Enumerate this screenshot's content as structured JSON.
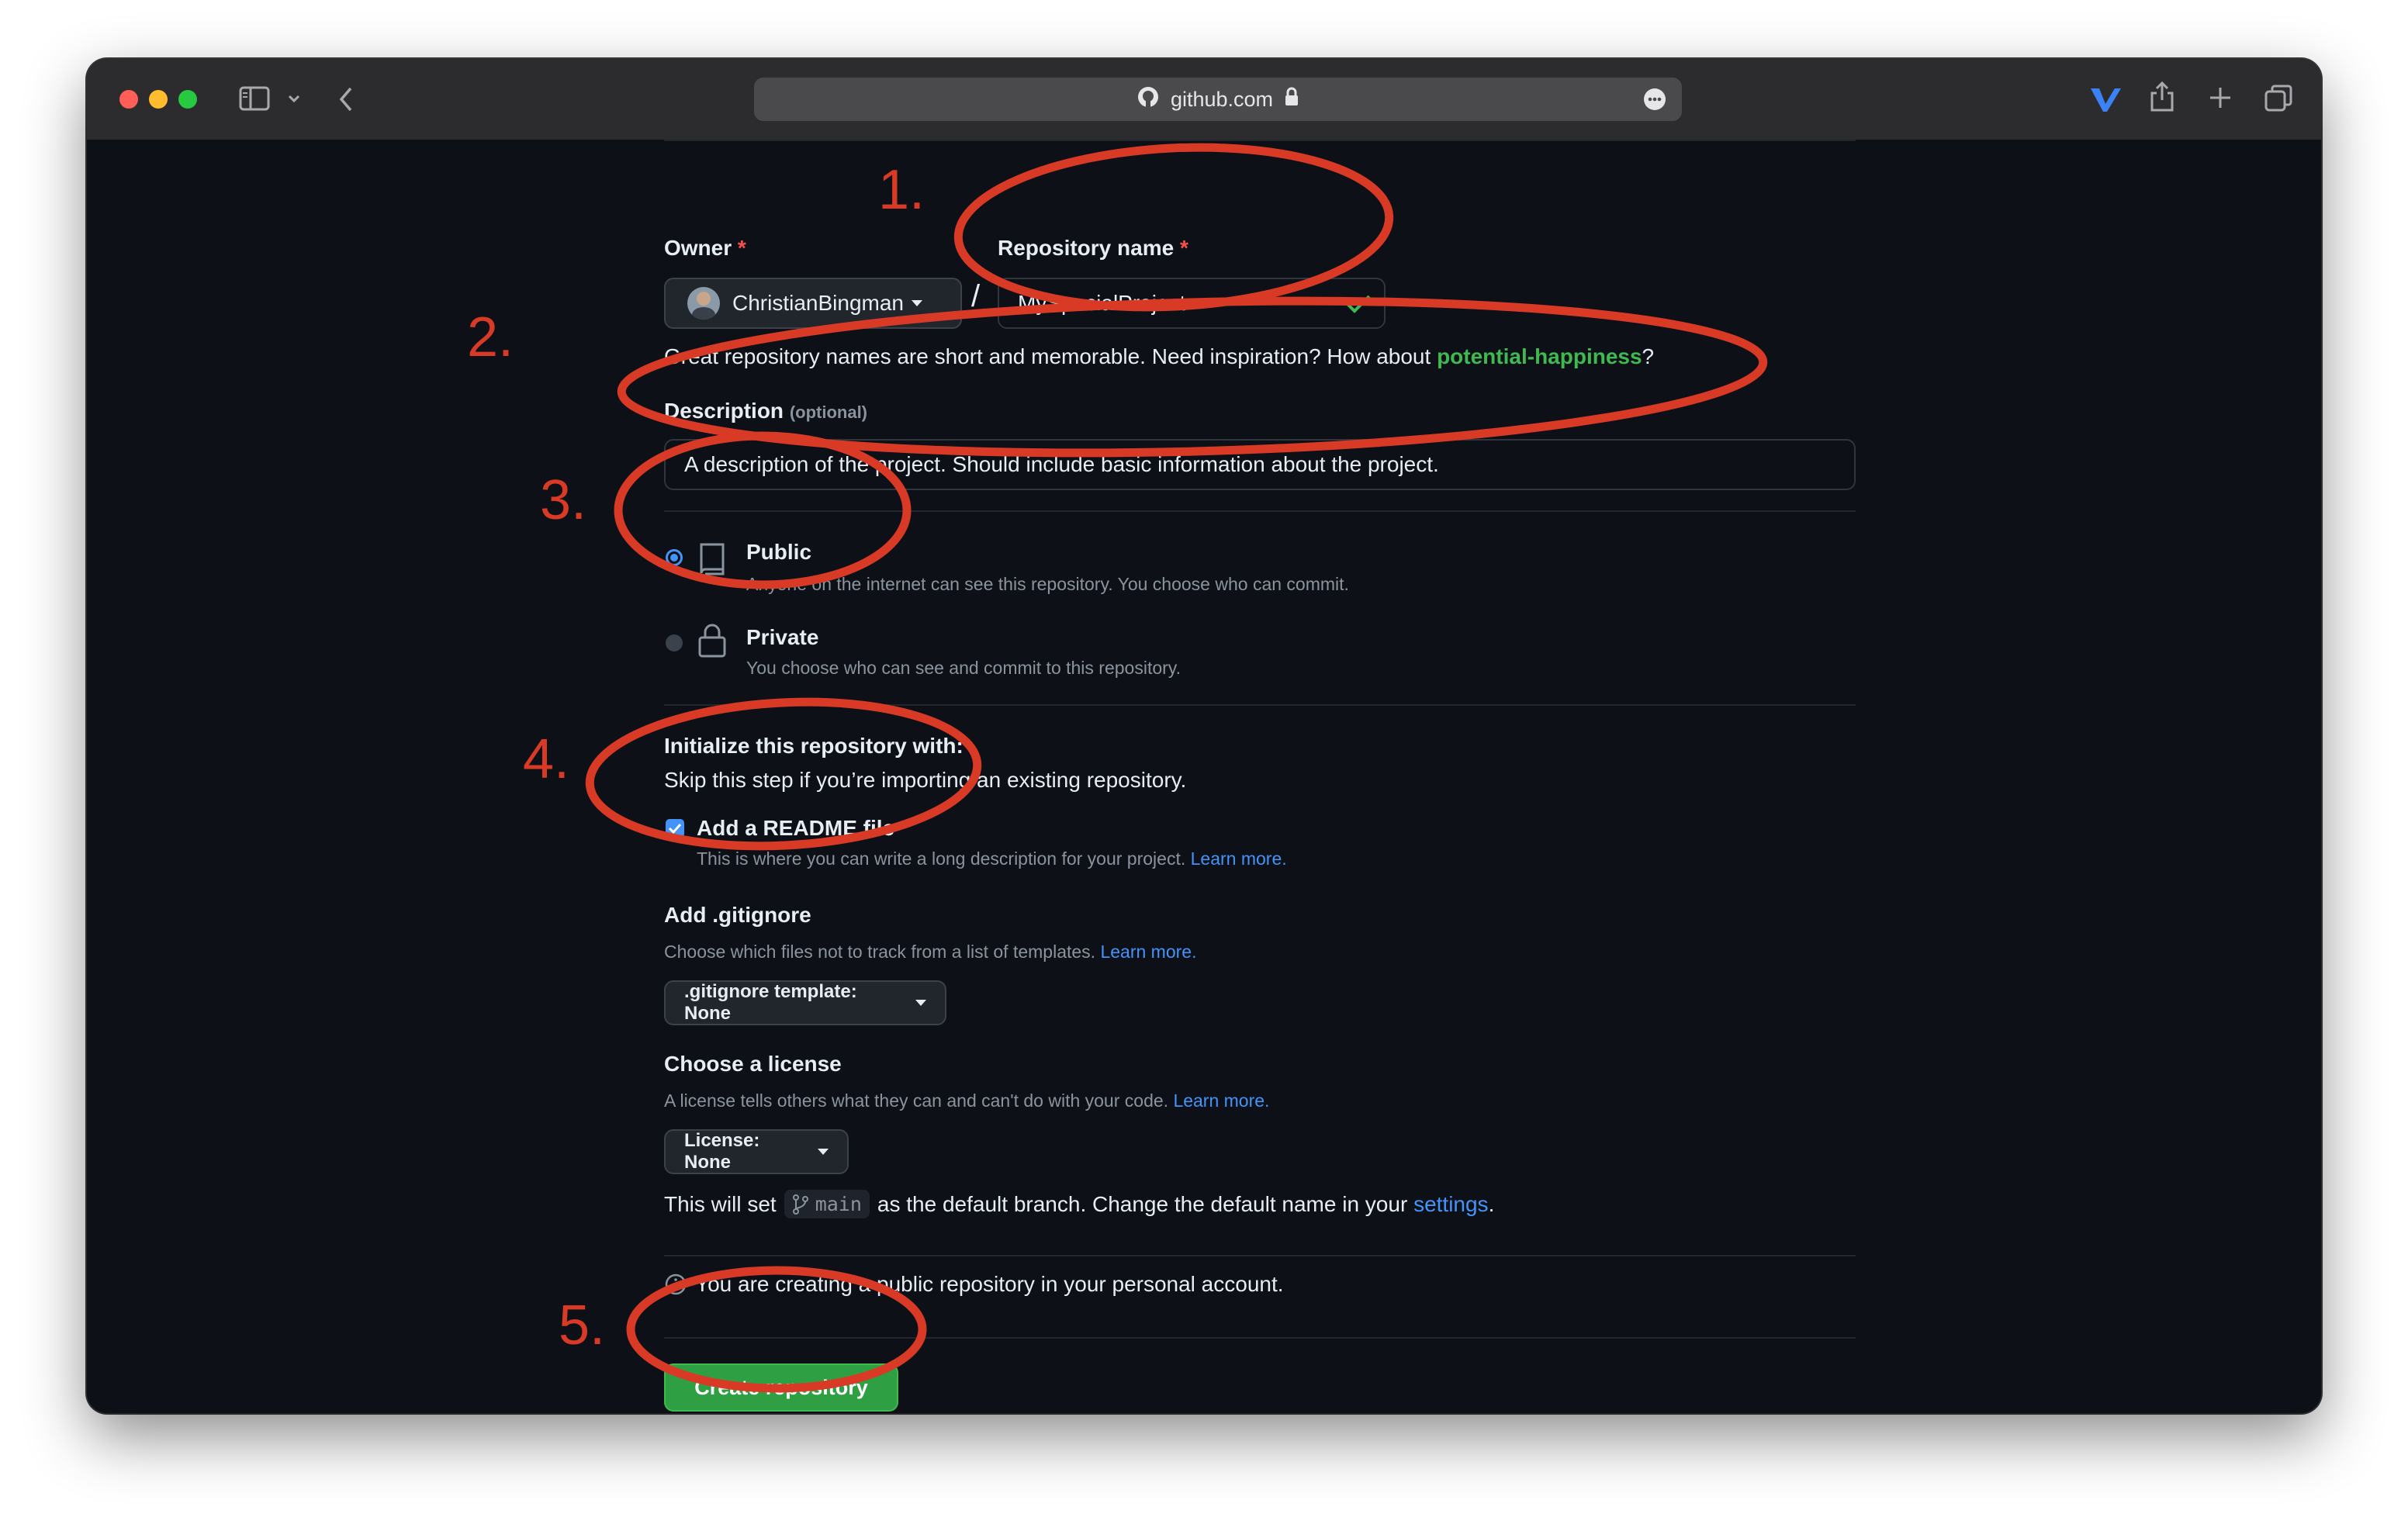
{
  "browser": {
    "url": "github.com"
  },
  "form": {
    "owner_label": "Owner",
    "required_mark": "*",
    "owner_value": "ChristianBingman",
    "slash": "/",
    "repo_name_label": "Repository name",
    "repo_name_value": "MySpecialProject",
    "suggestion_prefix": "Great repository names are short and memorable. Need inspiration? How about",
    "suggestion_name": "potential-happiness",
    "suggestion_suffix": "?",
    "description_label": "Description",
    "description_optional": "(optional)",
    "description_value": "A description of the project. Should include basic information about the project.",
    "visibility": {
      "selected": "Public",
      "public_title": "Public",
      "public_desc": "Anyone on the internet can see this repository. You choose who can commit.",
      "private_title": "Private",
      "private_desc": "You choose who can see and commit to this repository."
    },
    "init_title": "Initialize this repository with:",
    "init_desc": "Skip this step if you’re importing an existing repository.",
    "readme_title": "Add a README file",
    "readme_checked": true,
    "readme_desc": "This is where you can write a long description for your project.",
    "learn_more": "Learn more.",
    "gitignore_title": "Add .gitignore",
    "gitignore_desc": "Choose which files not to track from a list of templates.",
    "gitignore_button": ".gitignore template: None",
    "license_title": "Choose a license",
    "license_desc": "A license tells others what they can and can't do with your code.",
    "license_button": "License: None",
    "branch_prefix": "This will set",
    "branch_name": "main",
    "branch_suffix": "as the default branch. Change the default name in your",
    "settings_link": "settings",
    "period": ".",
    "public_notice": "You are creating a public repository in your personal account.",
    "create_button": "Create repository"
  },
  "annotations": {
    "step1": "1.",
    "step2": "2.",
    "step3": "3.",
    "step4": "4.",
    "step5": "5."
  },
  "colors": {
    "annotation_red": "#d93a26",
    "link_blue": "#4493f8",
    "success_green": "#3fb950",
    "button_green": "#2ea043",
    "background": "#0d1117"
  },
  "icons": [
    "sidebar-icon",
    "back-icon",
    "lock-icon",
    "more-icon",
    "share-icon",
    "new-tab-icon",
    "tabs-icon",
    "repo-icon",
    "lock-icon",
    "branch-icon",
    "info-icon",
    "check-icon"
  ]
}
